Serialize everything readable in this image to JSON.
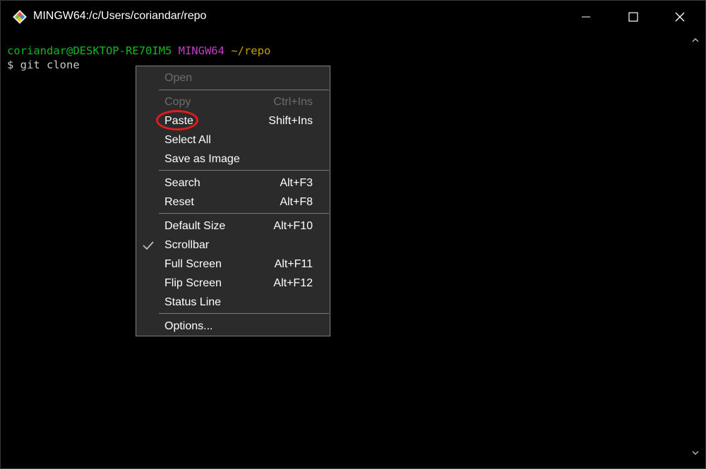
{
  "window": {
    "title": "MINGW64:/c/Users/coriandar/repo",
    "icon": "git-bash-icon",
    "controls": [
      "minimize-icon",
      "maximize-icon",
      "close-icon"
    ]
  },
  "terminal": {
    "prompt_user": "coriandar@DESKTOP-RE70IM5",
    "prompt_env": "MINGW64",
    "prompt_path": "~/repo",
    "command": "$ git clone"
  },
  "context_menu": {
    "items": [
      {
        "label": "Open",
        "shortcut": "",
        "disabled": true
      },
      {
        "label": "Copy",
        "shortcut": "Ctrl+Ins",
        "disabled": true
      },
      {
        "label": "Paste",
        "shortcut": "Shift+Ins",
        "disabled": false,
        "highlighted": true
      },
      {
        "label": "Select All",
        "shortcut": "",
        "disabled": false
      },
      {
        "label": "Save as Image",
        "shortcut": "",
        "disabled": false
      },
      {
        "label": "Search",
        "shortcut": "Alt+F3",
        "disabled": false
      },
      {
        "label": "Reset",
        "shortcut": "Alt+F8",
        "disabled": false
      },
      {
        "label": "Default Size",
        "shortcut": "Alt+F10",
        "disabled": false
      },
      {
        "label": "Scrollbar",
        "shortcut": "",
        "disabled": false,
        "checked": true
      },
      {
        "label": "Full Screen",
        "shortcut": "Alt+F11",
        "disabled": false
      },
      {
        "label": "Flip Screen",
        "shortcut": "Alt+F12",
        "disabled": false
      },
      {
        "label": "Status Line",
        "shortcut": "",
        "disabled": false
      },
      {
        "label": "Options...",
        "shortcut": "",
        "disabled": false
      }
    ]
  },
  "colors": {
    "prompt_user": "#14b823",
    "prompt_env": "#c040c0",
    "prompt_path": "#c4a000",
    "highlight_annotation": "#e01d1d",
    "menu_background": "#2b2b2b"
  }
}
